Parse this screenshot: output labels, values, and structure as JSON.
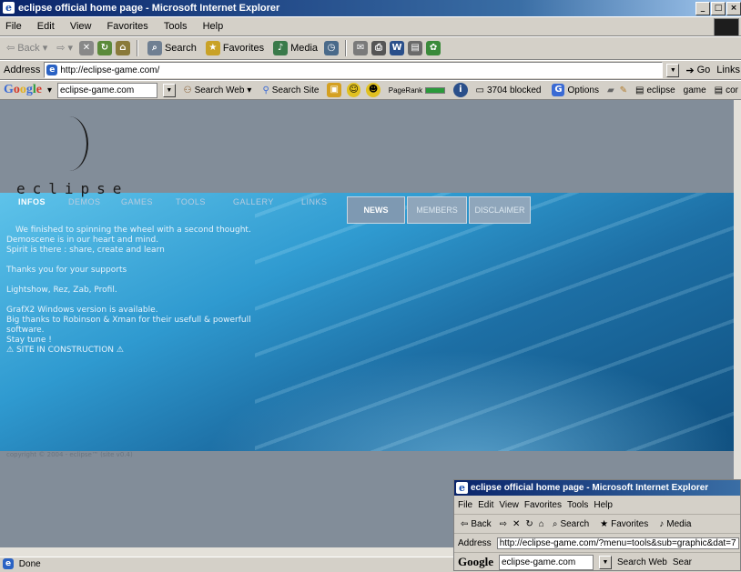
{
  "window": {
    "title": "eclipse official home page - Microsoft Internet Explorer",
    "controls": [
      "_",
      "□",
      "×"
    ]
  },
  "menu": [
    "File",
    "Edit",
    "View",
    "Favorites",
    "Tools",
    "Help"
  ],
  "toolbar": {
    "back": "Back",
    "search": "Search",
    "favorites": "Favorites",
    "media": "Media"
  },
  "address": {
    "label": "Address",
    "url": "http://eclipse-game.com/",
    "go": "Go",
    "links": "Links"
  },
  "googlebar": {
    "logo": "Google",
    "query": "eclipse-game.com",
    "search_web": "Search Web",
    "search_site": "Search Site",
    "pagerank": "PageRank",
    "blocked": "3704 blocked",
    "options": "Options",
    "tag1": "eclipse",
    "tag2": "game",
    "tag3": "cor"
  },
  "site": {
    "logo_text": "eclipse",
    "nav": [
      "INFOS",
      "DEMOS",
      "GAMES",
      "TOOLS",
      "GALLERY",
      "LINKS"
    ],
    "tabs": [
      "NEWS",
      "MEMBERS",
      "DISCLAIMER"
    ],
    "news": {
      "p1": "We finished to spinning the wheel with a second thought.",
      "p2": "Demoscene is in our heart and mind.",
      "p3": "Spirit is there : share, create and learn",
      "p4": "Thanks you for your supports",
      "p5": "Lightshow, Rez, Zab, Profil.",
      "p6": "GrafX2 Windows version is available.",
      "p7": "Big thanks to Robinson & Xman for their usefull & powerfull software.",
      "p8": "Stay tune !",
      "p9": "SITE IN CONSTRUCTION"
    },
    "copyright": "copyright © 2004 - eclipse™ (site v0.4)"
  },
  "status": {
    "text": "Done"
  },
  "window2": {
    "title": "eclipse official home page - Microsoft Internet Explorer",
    "menu": [
      "File",
      "Edit",
      "View",
      "Favorites",
      "Tools",
      "Help"
    ],
    "back": "Back",
    "search": "Search",
    "favorites": "Favorites",
    "media": "Media",
    "address_label": "Address",
    "url": "http://eclipse-game.com/?menu=tools&sub=graphic&dat=7",
    "google": "Google",
    "query": "eclipse-game.com",
    "search_web": "Search Web",
    "search_site_partial": "Sear"
  }
}
